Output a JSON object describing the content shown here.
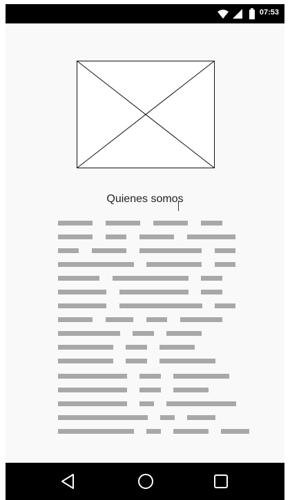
{
  "status_bar": {
    "time": "07:53",
    "icons": [
      "wifi-icon",
      "signal-icon",
      "battery-icon"
    ]
  },
  "content": {
    "image_placeholder": "image-placeholder",
    "title": "Quienes somos",
    "paragraph_placeholder_lines": 16
  },
  "nav_bar": {
    "buttons": [
      "back-icon",
      "home-icon",
      "recents-icon"
    ]
  },
  "colors": {
    "status_bar": "#000000",
    "nav_bar": "#000000",
    "background": "#f9f9f9",
    "text_line": "#a8a8a8"
  }
}
